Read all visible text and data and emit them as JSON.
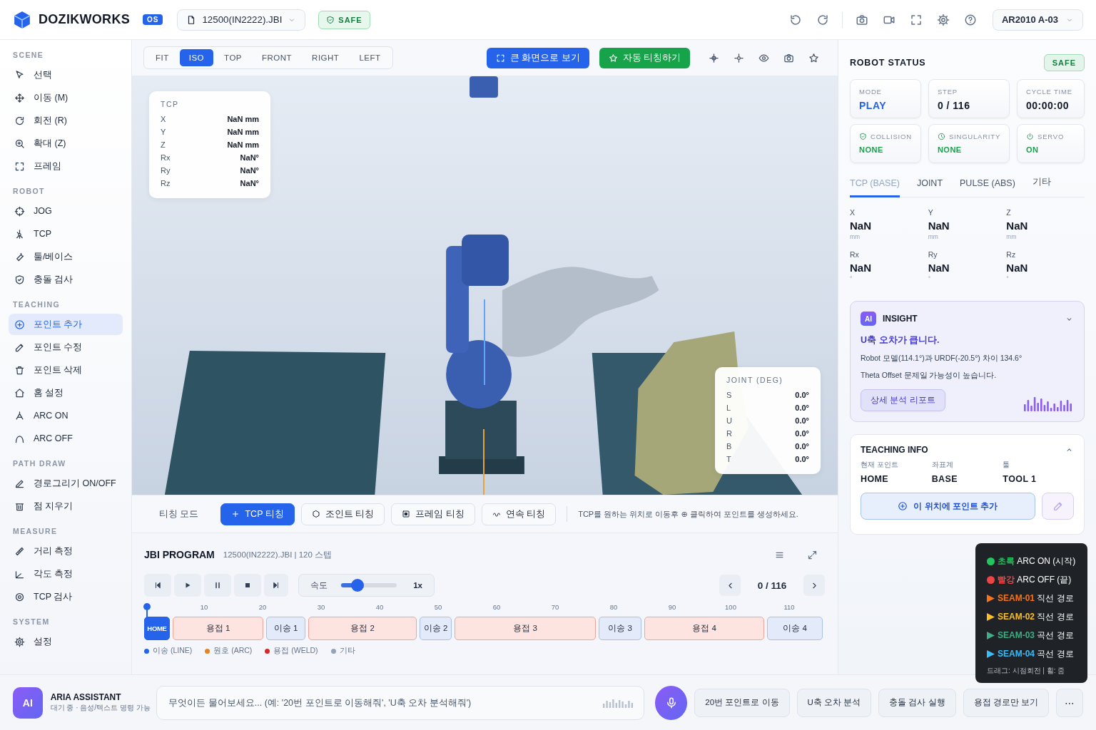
{
  "app": {
    "name": "DOZIKWORKS",
    "badge": "OS"
  },
  "file": {
    "name": "12500(IN2222).JBI"
  },
  "safety_badge": "SAFE",
  "robot_select": "AR2010 A-03",
  "sidebar": [
    {
      "title": "SCENE",
      "items": [
        {
          "label": "선택",
          "selected": false
        },
        {
          "label": "이동 (M)",
          "selected": false
        },
        {
          "label": "회전 (R)",
          "selected": false
        },
        {
          "label": "확대 (Z)",
          "selected": false
        },
        {
          "label": "프레임",
          "selected": false
        }
      ]
    },
    {
      "title": "ROBOT",
      "items": [
        {
          "label": "JOG",
          "selected": false
        },
        {
          "label": "TCP",
          "selected": false
        },
        {
          "label": "툴/베이스",
          "selected": false
        },
        {
          "label": "충돌 검사",
          "selected": false
        }
      ]
    },
    {
      "title": "TEACHING",
      "items": [
        {
          "label": "포인트 추가",
          "selected": true
        },
        {
          "label": "포인트 수정",
          "selected": false
        },
        {
          "label": "포인트 삭제",
          "selected": false
        },
        {
          "label": "홈 설정",
          "selected": false
        },
        {
          "label": "ARC ON",
          "selected": false
        },
        {
          "label": "ARC OFF",
          "selected": false
        }
      ]
    },
    {
      "title": "PATH DRAW",
      "items": [
        {
          "label": "경로그리기 ON/OFF",
          "selected": false
        },
        {
          "label": "점 지우기",
          "selected": false
        }
      ]
    },
    {
      "title": "MEASURE",
      "items": [
        {
          "label": "거리 측정",
          "selected": false
        },
        {
          "label": "각도 측정",
          "selected": false
        },
        {
          "label": "TCP 검사",
          "selected": false
        }
      ]
    },
    {
      "title": "SYSTEM",
      "items": [
        {
          "label": "설정",
          "selected": false
        }
      ]
    }
  ],
  "view_tabs": [
    {
      "label": "FIT",
      "selected": false
    },
    {
      "label": "ISO",
      "selected": true
    },
    {
      "label": "TOP",
      "selected": false
    },
    {
      "label": "FRONT",
      "selected": false
    },
    {
      "label": "RIGHT",
      "selected": false
    },
    {
      "label": "LEFT",
      "selected": false
    }
  ],
  "view_actions": [
    {
      "label": "큰 화면으로 보기",
      "kind": "fullscreen"
    },
    {
      "label": "자동 티칭하기",
      "kind": "auto"
    }
  ],
  "tcp_panel": {
    "title": "TCP",
    "rows": [
      {
        "axis": "X",
        "value": "NaN mm"
      },
      {
        "axis": "Y",
        "value": "NaN mm"
      },
      {
        "axis": "Z",
        "value": "NaN mm"
      },
      {
        "axis": "Rx",
        "value": "NaN°"
      },
      {
        "axis": "Ry",
        "value": "NaN°"
      },
      {
        "axis": "Rz",
        "value": "NaN°"
      }
    ]
  },
  "joint_panel": {
    "title": "JOINT (DEG)",
    "rows": [
      {
        "axis": "S",
        "value": "0.0°"
      },
      {
        "axis": "L",
        "value": "0.0°"
      },
      {
        "axis": "U",
        "value": "0.0°"
      },
      {
        "axis": "R",
        "value": "0.0°"
      },
      {
        "axis": "B",
        "value": "0.0°"
      },
      {
        "axis": "T",
        "value": "0.0°"
      }
    ]
  },
  "teach_mode": {
    "label": "티칭 모드",
    "buttons": [
      {
        "label": "TCP 티칭",
        "selected": true
      },
      {
        "label": "조인트 티칭",
        "selected": false
      },
      {
        "label": "프레임 티칭",
        "selected": false
      },
      {
        "label": "연속 티칭",
        "selected": false
      }
    ],
    "hint": "TCP를 원하는 위치로 이동후 ⊕ 클릭하여 포인트를 생성하세요."
  },
  "program": {
    "title": "JBI PROGRAM",
    "subtitle": "12500(IN2222).JBI | 120 스텝",
    "speed_label": "속도",
    "speed": {
      "level": 0.25
    },
    "speed_value": "1x",
    "step": "0 / 116",
    "ticks": [
      "10",
      "20",
      "30",
      "40",
      "50",
      "60",
      "70",
      "80",
      "90",
      "100",
      "110"
    ],
    "segments": [
      {
        "label": "HOME",
        "kind": "home"
      },
      {
        "label": "용접 1",
        "kind": "weld"
      },
      {
        "label": "이송 1",
        "kind": "move"
      },
      {
        "label": "용접 2",
        "kind": "weld"
      },
      {
        "label": "이송 2",
        "kind": "move"
      },
      {
        "label": "용접 3",
        "kind": "weld"
      },
      {
        "label": "이송 3",
        "kind": "move"
      },
      {
        "label": "용접 4",
        "kind": "weld"
      },
      {
        "label": "이송 4",
        "kind": "move"
      }
    ],
    "legend": [
      {
        "label": "이송 (LINE)",
        "color": "#2563eb"
      },
      {
        "label": "원호 (ARC)",
        "color": "#e8821e"
      },
      {
        "label": "용접 (WELD)",
        "color": "#dc2626"
      },
      {
        "label": "기타",
        "color": "#94a3b8"
      }
    ]
  },
  "robot_status": {
    "title": "ROBOT STATUS",
    "badge": "SAFE",
    "cards": [
      {
        "label": "MODE",
        "value": "PLAY",
        "kind": "mode"
      },
      {
        "label": "STEP",
        "value": "0 / 116",
        "kind": "plain"
      },
      {
        "label": "CYCLE TIME",
        "value": "00:00:00",
        "kind": "plain"
      },
      {
        "label": "COLLISION",
        "value": "NONE",
        "kind": "collision"
      },
      {
        "label": "SINGULARITY",
        "value": "NONE",
        "kind": "singularity"
      },
      {
        "label": "SERVO",
        "value": "ON",
        "kind": "servo"
      }
    ]
  },
  "coord_tabs": [
    {
      "label": "TCP (BASE)",
      "selected": true
    },
    {
      "label": "JOINT",
      "selected": false
    },
    {
      "label": "PULSE (ABS)",
      "selected": false
    },
    {
      "label": "기타",
      "selected": false
    }
  ],
  "coords": [
    {
      "axis": "X",
      "value": "NaN",
      "unit": "mm"
    },
    {
      "axis": "Y",
      "value": "NaN",
      "unit": "mm"
    },
    {
      "axis": "Z",
      "value": "NaN",
      "unit": "mm"
    },
    {
      "axis": "Rx",
      "value": "NaN",
      "unit": "°"
    },
    {
      "axis": "Ry",
      "value": "NaN",
      "unit": "°"
    },
    {
      "axis": "Rz",
      "value": "NaN",
      "unit": "°"
    }
  ],
  "insight": {
    "badge": "AI",
    "title": "INSIGHT",
    "headline": "U축 오차가 큽니다.",
    "lines": [
      "Robot 모델(114.1°)과 URDF(-20.5°) 차이 134.6°",
      "Theta Offset 문제일 가능성이 높습니다."
    ],
    "button": "상세 분석 리포트"
  },
  "teaching_info": {
    "title": "TEACHING INFO",
    "fields": [
      {
        "label": "현재 포인트",
        "value": "HOME"
      },
      {
        "label": "좌표계",
        "value": "BASE"
      },
      {
        "label": "툴",
        "value": "TOOL 1"
      }
    ],
    "add_button": "이 위치에 포인트 추가"
  },
  "path_legend": {
    "items": [
      {
        "kind": "dot",
        "color": "#22c55e",
        "name": "초록",
        "text": "ARC ON (시작)"
      },
      {
        "kind": "dot",
        "color": "#ef4444",
        "name": "빨강",
        "text": "ARC OFF (끝)"
      },
      {
        "kind": "arrow",
        "color": "#f97316",
        "name": "SEAM-01",
        "text": "직선 경로"
      },
      {
        "kind": "arrow",
        "color": "#fbbf24",
        "name": "SEAM-02",
        "text": "직선 경로"
      },
      {
        "kind": "arrow",
        "color": "#3fae84",
        "name": "SEAM-03",
        "text": "곡선 경로"
      },
      {
        "kind": "arrow",
        "color": "#38bdf8",
        "name": "SEAM-04",
        "text": "곡선 경로"
      }
    ],
    "hint": "드래그: 시점회전 | 휠: 줌"
  },
  "assistant": {
    "badge": "AI",
    "name": "ARIA ASSISTANT",
    "status": "대기 중 · 음성/텍스트 명령 가능",
    "placeholder": "무엇이든 물어보세요... (예: '20번 포인트로 이동해줘', 'U축 오차 분석해줘')",
    "quick_actions": [
      "20번 포인트로 이동",
      "U축 오차 분석",
      "충돌 검사 실행",
      "용접 경로만 보기"
    ],
    "more": "⋯"
  }
}
